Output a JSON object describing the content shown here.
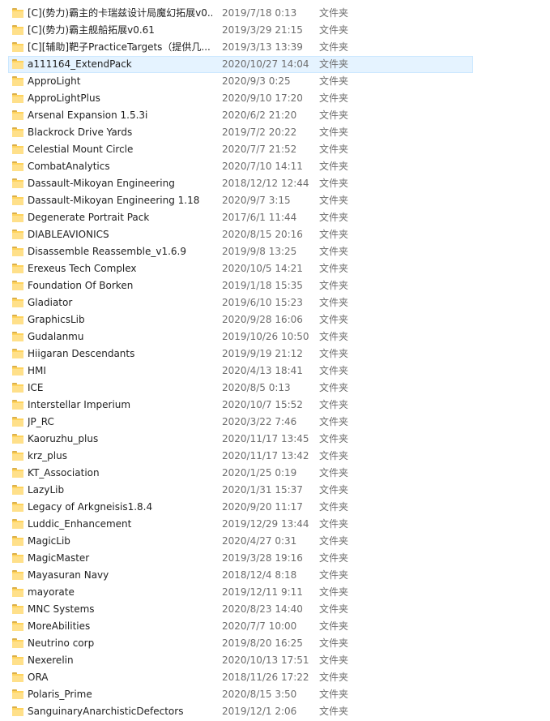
{
  "file_list": {
    "selected_index": 3,
    "icon": "folder-icon",
    "rows": [
      {
        "name": "[C](势力)霸主的卡瑞兹设计局魔幻拓展v0...",
        "date": "2019/7/18 0:13",
        "type": "文件夹"
      },
      {
        "name": "[C](势力)霸主舰船拓展v0.61",
        "date": "2019/3/29 21:15",
        "type": "文件夹"
      },
      {
        "name": "[C][辅助]靶子PracticeTargets（提供几...",
        "date": "2019/3/13 13:39",
        "type": "文件夹"
      },
      {
        "name": "a111164_ExtendPack",
        "date": "2020/10/27 14:04",
        "type": "文件夹"
      },
      {
        "name": "ApproLight",
        "date": "2020/9/3 0:25",
        "type": "文件夹"
      },
      {
        "name": "ApproLightPlus",
        "date": "2020/9/10 17:20",
        "type": "文件夹"
      },
      {
        "name": "Arsenal Expansion 1.5.3i",
        "date": "2020/6/2 21:20",
        "type": "文件夹"
      },
      {
        "name": "Blackrock Drive Yards",
        "date": "2019/7/2 20:22",
        "type": "文件夹"
      },
      {
        "name": "Celestial Mount Circle",
        "date": "2020/7/7 21:52",
        "type": "文件夹"
      },
      {
        "name": "CombatAnalytics",
        "date": "2020/7/10 14:11",
        "type": "文件夹"
      },
      {
        "name": "Dassault-Mikoyan Engineering",
        "date": "2018/12/12 12:44",
        "type": "文件夹"
      },
      {
        "name": "Dassault-Mikoyan Engineering 1.18",
        "date": "2020/9/7 3:15",
        "type": "文件夹"
      },
      {
        "name": "Degenerate Portrait Pack",
        "date": "2017/6/1 11:44",
        "type": "文件夹"
      },
      {
        "name": "DIABLEAVIONICS",
        "date": "2020/8/15 20:16",
        "type": "文件夹"
      },
      {
        "name": "Disassemble Reassemble_v1.6.9",
        "date": "2019/9/8 13:25",
        "type": "文件夹"
      },
      {
        "name": "Erexeus Tech Complex",
        "date": "2020/10/5 14:21",
        "type": "文件夹"
      },
      {
        "name": "Foundation Of Borken",
        "date": "2019/1/18 15:35",
        "type": "文件夹"
      },
      {
        "name": "Gladiator",
        "date": "2019/6/10 15:23",
        "type": "文件夹"
      },
      {
        "name": "GraphicsLib",
        "date": "2020/9/28 16:06",
        "type": "文件夹"
      },
      {
        "name": "Gudalanmu",
        "date": "2019/10/26 10:50",
        "type": "文件夹"
      },
      {
        "name": "Hiigaran Descendants",
        "date": "2019/9/19 21:12",
        "type": "文件夹"
      },
      {
        "name": "HMI",
        "date": "2020/4/13 18:41",
        "type": "文件夹"
      },
      {
        "name": "ICE",
        "date": "2020/8/5 0:13",
        "type": "文件夹"
      },
      {
        "name": "Interstellar Imperium",
        "date": "2020/10/7 15:52",
        "type": "文件夹"
      },
      {
        "name": "JP_RC",
        "date": "2020/3/22 7:46",
        "type": "文件夹"
      },
      {
        "name": "Kaoruzhu_plus",
        "date": "2020/11/17 13:45",
        "type": "文件夹"
      },
      {
        "name": "krz_plus",
        "date": "2020/11/17 13:42",
        "type": "文件夹"
      },
      {
        "name": "KT_Association",
        "date": "2020/1/25 0:19",
        "type": "文件夹"
      },
      {
        "name": "LazyLib",
        "date": "2020/1/31 15:37",
        "type": "文件夹"
      },
      {
        "name": "Legacy of Arkgneisis1.8.4",
        "date": "2020/9/20 11:17",
        "type": "文件夹"
      },
      {
        "name": "Luddic_Enhancement",
        "date": "2019/12/29 13:44",
        "type": "文件夹"
      },
      {
        "name": "MagicLib",
        "date": "2020/4/27 0:31",
        "type": "文件夹"
      },
      {
        "name": "MagicMaster",
        "date": "2019/3/28 19:16",
        "type": "文件夹"
      },
      {
        "name": "Mayasuran Navy",
        "date": "2018/12/4 8:18",
        "type": "文件夹"
      },
      {
        "name": "mayorate",
        "date": "2019/12/11 9:11",
        "type": "文件夹"
      },
      {
        "name": "MNC Systems",
        "date": "2020/8/23 14:40",
        "type": "文件夹"
      },
      {
        "name": "MoreAbilities",
        "date": "2020/7/7 10:00",
        "type": "文件夹"
      },
      {
        "name": "Neutrino corp",
        "date": "2019/8/20 16:25",
        "type": "文件夹"
      },
      {
        "name": "Nexerelin",
        "date": "2020/10/13 17:51",
        "type": "文件夹"
      },
      {
        "name": "ORA",
        "date": "2018/11/26 17:22",
        "type": "文件夹"
      },
      {
        "name": "Polaris_Prime",
        "date": "2020/8/15 3:50",
        "type": "文件夹"
      },
      {
        "name": "SanguinaryAnarchisticDefectors",
        "date": "2019/12/1 2:06",
        "type": "文件夹"
      }
    ]
  }
}
